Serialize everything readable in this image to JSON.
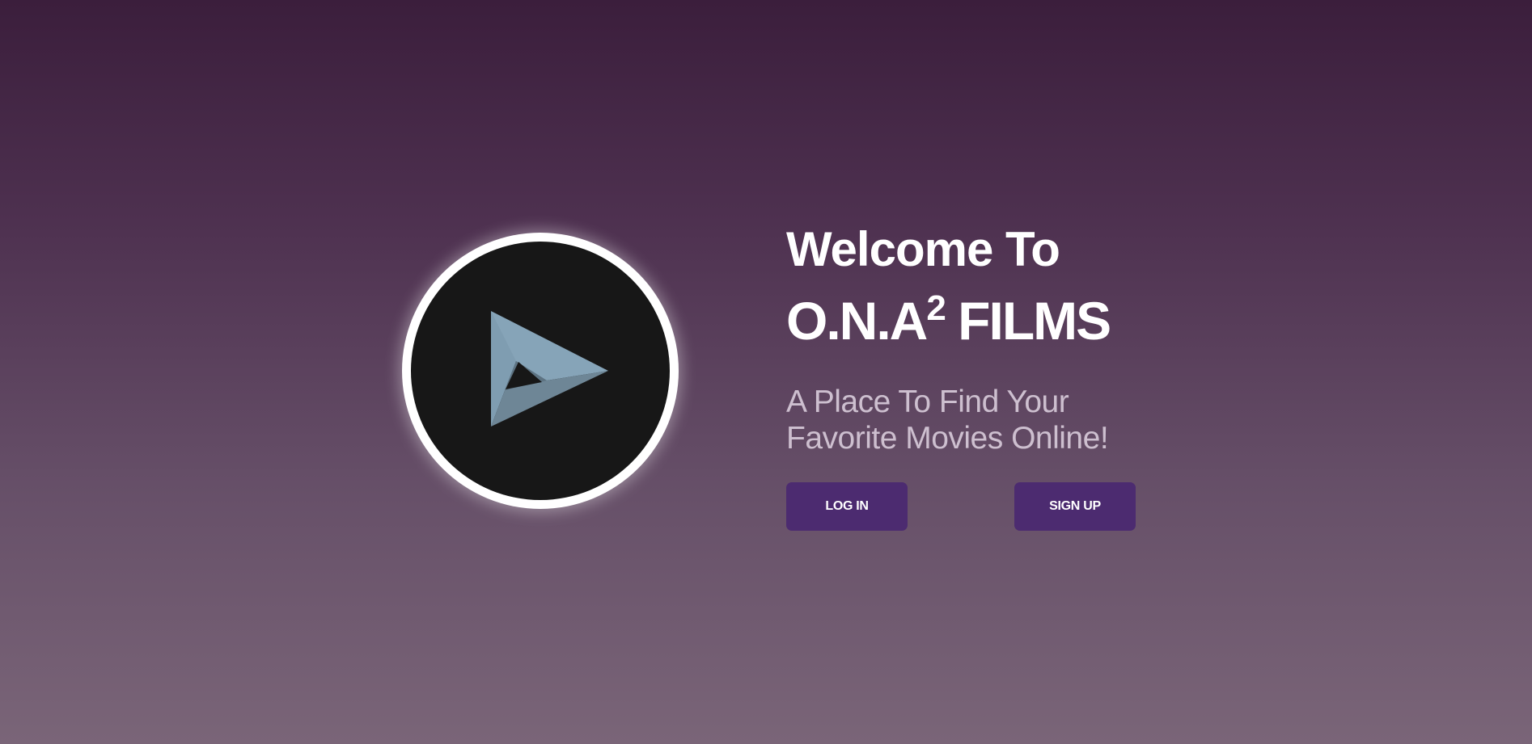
{
  "hero": {
    "welcome": "Welcome To",
    "brand_name": "O.N.A",
    "brand_superscript": "2",
    "brand_suffix": " FILMS",
    "tagline": "A Place To Find Your Favorite Movies Online!"
  },
  "actions": {
    "login_label": "LOG IN",
    "signup_label": "SIGN UP"
  },
  "logo": {
    "icon": "play-triangle-icon"
  },
  "colors": {
    "background_top": "#3b1e3c",
    "background_bottom": "#7a6578",
    "button": "#4c2b70",
    "logo_disc": "#171717",
    "logo_ring": "#ffffff",
    "tagline": "#cdbfcf"
  }
}
